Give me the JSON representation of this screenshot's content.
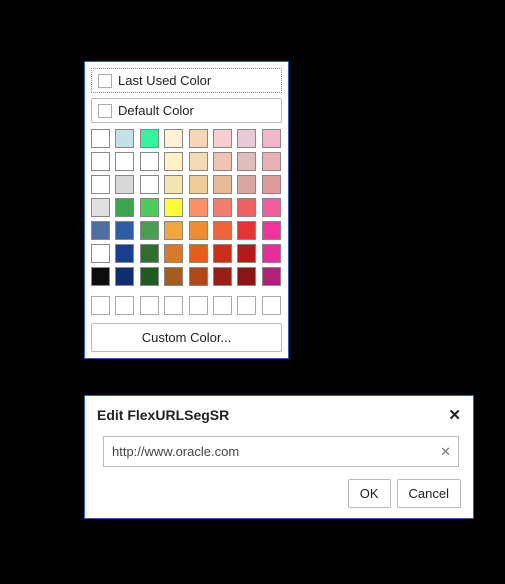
{
  "color_picker": {
    "last_used_label": "Last Used Color",
    "default_label": "Default Color",
    "custom_label": "Custom Color...",
    "swatches": [
      "#ffffff",
      "#c4e1e8",
      "#33f59a",
      "#fff2d6",
      "#f7d6b8",
      "#f5cfcf",
      "#e8c9d6",
      "#f0b8c9",
      "#ffffff",
      "#ffffff",
      "#ffffff",
      "#fff2c4",
      "#f5d9b3",
      "#f0c4b3",
      "#e0bdbd",
      "#e8b0b0",
      "#ffffff",
      "#d9d9d9",
      "#ffffff",
      "#f5e6b0",
      "#f0cc99",
      "#e8b899",
      "#d9a6a3",
      "#e09999",
      "#e0e0e0",
      "#3da64d",
      "#4dcc5c",
      "#ffff33",
      "#ff8f66",
      "#f57a70",
      "#f26161",
      "#f55c9c",
      "#4d6fa6",
      "#2e5ca6",
      "#4a9e52",
      "#f2a640",
      "#f28c33",
      "#f26636",
      "#e63333",
      "#f53399",
      "#ffffff",
      "#1a3d8f",
      "#2e6e2e",
      "#d97a26",
      "#e65c1a",
      "#cc2e1a",
      "#b31a1a",
      "#e62e99",
      "#0d0d0d",
      "#0f2e70",
      "#1f5c1f",
      "#a65c1a",
      "#b34717",
      "#991f14",
      "#8c1414",
      "#b31f7a"
    ],
    "recent_slots": 8
  },
  "url_dialog": {
    "title": "Edit FlexURLSegSR",
    "value": "http://www.oracle.com",
    "placeholder": "",
    "ok_label": "OK",
    "cancel_label": "Cancel"
  }
}
